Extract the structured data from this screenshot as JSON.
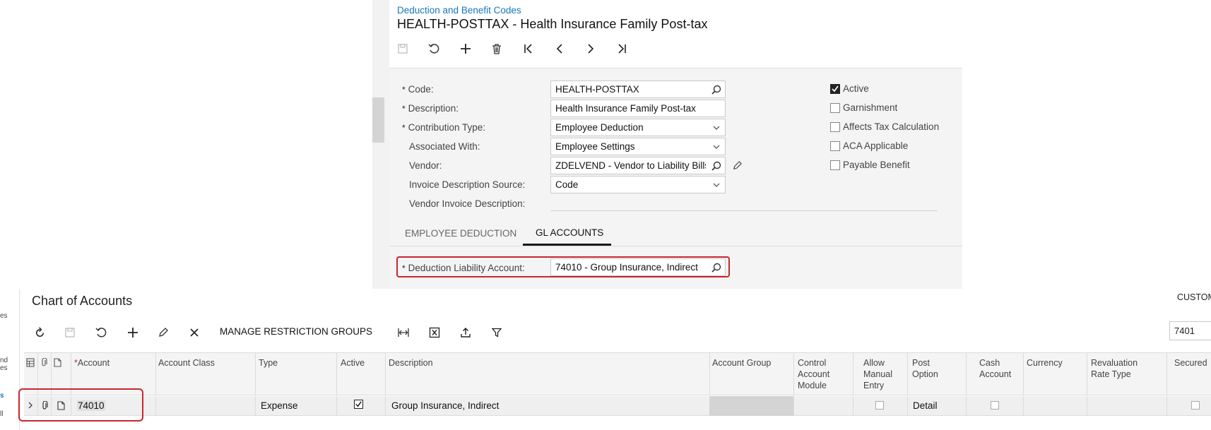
{
  "top": {
    "breadcrumb": "Deduction and Benefit Codes",
    "title": "HEALTH-POSTTAX - Health Insurance Family Post-tax",
    "toolbar": [
      "save-icon",
      "undo-icon",
      "add-icon",
      "delete-icon",
      "first-icon",
      "previous-icon",
      "next-icon",
      "last-icon"
    ],
    "fields": {
      "code": {
        "label": "Code:",
        "required": "*",
        "value": "HEALTH-POSTTAX"
      },
      "description": {
        "label": "Description:",
        "required": "*",
        "value": "Health Insurance Family Post-tax"
      },
      "contribution_type": {
        "label": "Contribution Type:",
        "required": "*",
        "value": "Employee Deduction"
      },
      "associated_with": {
        "label": "Associated With:",
        "value": "Employee Settings"
      },
      "vendor": {
        "label": "Vendor:",
        "value": "ZDELVEND - Vendor to Liability Bills D"
      },
      "invoice_desc_source": {
        "label": "Invoice Description Source:",
        "value": "Code"
      },
      "vendor_invoice_desc": {
        "label": "Vendor Invoice Description:",
        "value": ""
      }
    },
    "checkboxes": [
      {
        "label": "Active",
        "checked": true
      },
      {
        "label": "Garnishment",
        "checked": false
      },
      {
        "label": "Affects Tax Calculation",
        "checked": false
      },
      {
        "label": "ACA Applicable",
        "checked": false
      },
      {
        "label": "Payable Benefit",
        "checked": false
      }
    ],
    "tabs": [
      "EMPLOYEE DEDUCTION",
      "GL ACCOUNTS"
    ],
    "active_tab": "GL ACCOUNTS",
    "deduction_liability": {
      "label": "Deduction Liability Account:",
      "required": "*",
      "value": "74010 - Group Insurance, Indirect"
    }
  },
  "left_edge": [
    "es",
    "nd",
    "es",
    "s",
    "ll"
  ],
  "coa": {
    "title": "Chart of Accounts",
    "custom_label": "CUSTOM",
    "search_value": "7401",
    "manage_label": "MANAGE RESTRICTION GROUPS",
    "columns": {
      "account": {
        "required": "*",
        "label": "Account"
      },
      "account_class": "Account Class",
      "type": "Type",
      "active": "Active",
      "description": "Description",
      "account_group": "Account Group",
      "control_account_module": "Control Account Module",
      "allow_manual_entry": "Allow Manual Entry",
      "post_option": "Post Option",
      "cash_account": "Cash Account",
      "currency": "Currency",
      "revaluation_rate_type": "Revaluation Rate Type",
      "secured": "Secured"
    },
    "rows": [
      {
        "account": "74010",
        "account_class": "",
        "type": "Expense",
        "active": true,
        "description": "Group Insurance, Indirect",
        "account_group": "",
        "control_account_module": "",
        "allow_manual_entry": false,
        "post_option": "Detail",
        "cash_account": false,
        "currency": "",
        "revaluation_rate_type": "",
        "secured": false
      }
    ]
  },
  "colors": {
    "accent": "#1976b8",
    "highlight": "#c8262f"
  }
}
